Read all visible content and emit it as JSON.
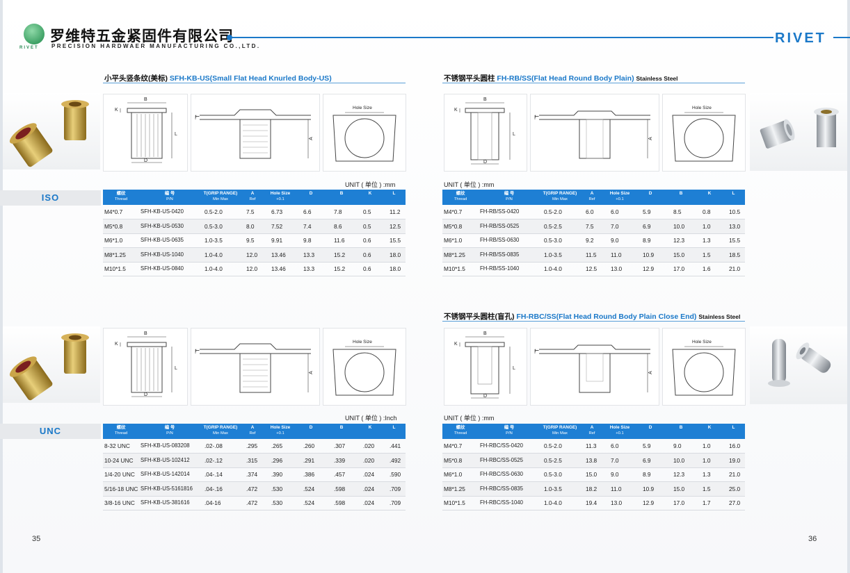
{
  "header": {
    "company_cn": "罗维特五金紧固件有限公司",
    "company_en": "PRECISION HARDWAER MANUFACTURING CO.,LTD.",
    "logo_caption": "RIVET",
    "brand": "RIVET"
  },
  "sections": [
    {
      "cn": "小平头竖条纹(美标)",
      "code": "SFH-KB-US(Small Flat Head  Knurled Body-US)",
      "ss": "",
      "unit": "UNIT ( 单位 ) :mm",
      "columns": [
        {
          "a": "螺纹",
          "b": "Thread"
        },
        {
          "a": "编 号",
          "b": "P/N"
        },
        {
          "a": "T(GRIP RANGE)",
          "b": "Min Max"
        },
        {
          "a": "A",
          "b": "Ref"
        },
        {
          "a": "Hole Size",
          "b": "+0.1"
        },
        {
          "a": "D",
          "b": ""
        },
        {
          "a": "B",
          "b": ""
        },
        {
          "a": "K",
          "b": ""
        },
        {
          "a": "L",
          "b": ""
        }
      ],
      "rows": [
        [
          "M4*0.7",
          "SFH-KB-US-0420",
          "0.5-2.0",
          "7.5",
          "6.73",
          "6.6",
          "7.8",
          "0.5",
          "11.2"
        ],
        [
          "M5*0.8",
          "SFH-KB-US-0530",
          "0.5-3.0",
          "8.0",
          "7.52",
          "7.4",
          "8.6",
          "0.5",
          "12.5"
        ],
        [
          "M6*1.0",
          "SFH-KB-US-0635",
          "1.0-3.5",
          "9.5",
          "9.91",
          "9.8",
          "11.6",
          "0.6",
          "15.5"
        ],
        [
          "M8*1.25",
          "SFH-KB-US-1040",
          "1.0-4.0",
          "12.0",
          "13.46",
          "13.3",
          "15.2",
          "0.6",
          "18.0"
        ],
        [
          "M10*1.5",
          "SFH-KB-US-0840",
          "1.0-4.0",
          "12.0",
          "13.46",
          "13.3",
          "15.2",
          "0.6",
          "18.0"
        ]
      ]
    },
    {
      "cn": "不锈钢平头圆柱",
      "code": "FH-RB/SS(Flat  Head Round  Body Plain)",
      "ss": "Stainless Steel",
      "unit": "UNIT ( 单位 ) :mm",
      "columns": [
        {
          "a": "螺纹",
          "b": "Thread"
        },
        {
          "a": "编 号",
          "b": "P/N"
        },
        {
          "a": "T(GRIP RANGE)",
          "b": "Min Max"
        },
        {
          "a": "A",
          "b": "Ref"
        },
        {
          "a": "Hole Size",
          "b": "+0.1"
        },
        {
          "a": "D",
          "b": ""
        },
        {
          "a": "B",
          "b": ""
        },
        {
          "a": "K",
          "b": ""
        },
        {
          "a": "L",
          "b": ""
        }
      ],
      "rows": [
        [
          "M4*0.7",
          "FH-RB/SS-0420",
          "0.5-2.0",
          "6.0",
          "6.0",
          "5.9",
          "8.5",
          "0.8",
          "10.5"
        ],
        [
          "M5*0.8",
          "FH-RB/SS-0525",
          "0.5-2.5",
          "7.5",
          "7.0",
          "6.9",
          "10.0",
          "1.0",
          "13.0"
        ],
        [
          "M6*1.0",
          "FH-RB/SS-0630",
          "0.5-3.0",
          "9.2",
          "9.0",
          "8.9",
          "12.3",
          "1.3",
          "15.5"
        ],
        [
          "M8*1.25",
          "FH-RB/SS-0835",
          "1.0-3.5",
          "11.5",
          "11.0",
          "10.9",
          "15.0",
          "1.5",
          "18.5"
        ],
        [
          "M10*1.5",
          "FH-RB/SS-1040",
          "1.0-4.0",
          "12.5",
          "13.0",
          "12.9",
          "17.0",
          "1.6",
          "21.0"
        ]
      ]
    },
    {
      "cn": "",
      "code": "",
      "ss": "",
      "unit": "UNIT ( 单位 ) :Inch",
      "columns": [
        {
          "a": "螺纹",
          "b": "Thread"
        },
        {
          "a": "编 号",
          "b": "P/N"
        },
        {
          "a": "T(GRIP RANGE)",
          "b": "Min Max"
        },
        {
          "a": "A",
          "b": "Ref"
        },
        {
          "a": "Hole Size",
          "b": "+0.1"
        },
        {
          "a": "D",
          "b": ""
        },
        {
          "a": "B",
          "b": ""
        },
        {
          "a": "K",
          "b": ""
        },
        {
          "a": "L",
          "b": ""
        }
      ],
      "rows": [
        [
          "8-32 UNC",
          "SFH-KB-US-083208",
          ".02-.08",
          ".295",
          ".265",
          ".260",
          ".307",
          ".020",
          ".441"
        ],
        [
          "10-24 UNC",
          "SFH-KB-US-102412",
          ".02-.12",
          ".315",
          ".296",
          ".291",
          ".339",
          ".020",
          ".492"
        ],
        [
          "1/4-20 UNC",
          "SFH-KB-US-142014",
          ".04-.14",
          ".374",
          ".390",
          ".386",
          ".457",
          ".024",
          ".590"
        ],
        [
          "5/16-18 UNC",
          "SFH-KB-US-5161816",
          ".04-.16",
          ".472",
          ".530",
          ".524",
          ".598",
          ".024",
          ".709"
        ],
        [
          "3/8-16 UNC",
          "SFH-KB-US-381616",
          ".04-16",
          ".472",
          ".530",
          ".524",
          ".598",
          ".024",
          ".709"
        ]
      ]
    },
    {
      "cn": "不锈钢平头圆柱(盲孔)",
      "code": "FH-RBC/SS(Flat  Head Round  Body Plain Close End)",
      "ss": "Stainless Steel",
      "unit": "UNIT ( 单位 ) :mm",
      "columns": [
        {
          "a": "螺纹",
          "b": "Thread"
        },
        {
          "a": "编 号",
          "b": "P/N"
        },
        {
          "a": "T(GRIP RANGE)",
          "b": "Min Max"
        },
        {
          "a": "A",
          "b": "Ref"
        },
        {
          "a": "Hole Size",
          "b": "+0.1"
        },
        {
          "a": "D",
          "b": ""
        },
        {
          "a": "B",
          "b": ""
        },
        {
          "a": "K",
          "b": ""
        },
        {
          "a": "L",
          "b": ""
        }
      ],
      "rows": [
        [
          "M4*0.7",
          "FH-RBC/SS-0420",
          "0.5-2.0",
          "11.3",
          "6.0",
          "5.9",
          "9.0",
          "1.0",
          "16.0"
        ],
        [
          "M5*0.8",
          "FH-RBC/SS-0525",
          "0.5-2.5",
          "13.8",
          "7.0",
          "6.9",
          "10.0",
          "1.0",
          "19.0"
        ],
        [
          "M6*1.0",
          "FH-RBC/SS-0630",
          "0.5-3.0",
          "15.0",
          "9.0",
          "8.9",
          "12.3",
          "1.3",
          "21.0"
        ],
        [
          "M8*1.25",
          "FH-RBC/SS-0835",
          "1.0-3.5",
          "18.2",
          "11.0",
          "10.9",
          "15.0",
          "1.5",
          "25.0"
        ],
        [
          "M10*1.5",
          "FH-RBC/SS-1040",
          "1.0-4.0",
          "19.4",
          "13.0",
          "12.9",
          "17.0",
          "1.7",
          "27.0"
        ]
      ]
    }
  ],
  "drawing_labels": {
    "b": "B",
    "k": "K",
    "t": "T",
    "l": "L",
    "d": "D",
    "a": "A",
    "hole": "Hole Size"
  },
  "side_tags": {
    "iso": "ISO",
    "unc": "UNC"
  },
  "pages": {
    "left": "35",
    "right": "36"
  },
  "colors": {
    "accent": "#1a78c8",
    "header_bar": "#1e7fd4",
    "gold": "#c9a23a",
    "steel": "#c8ccd2"
  }
}
